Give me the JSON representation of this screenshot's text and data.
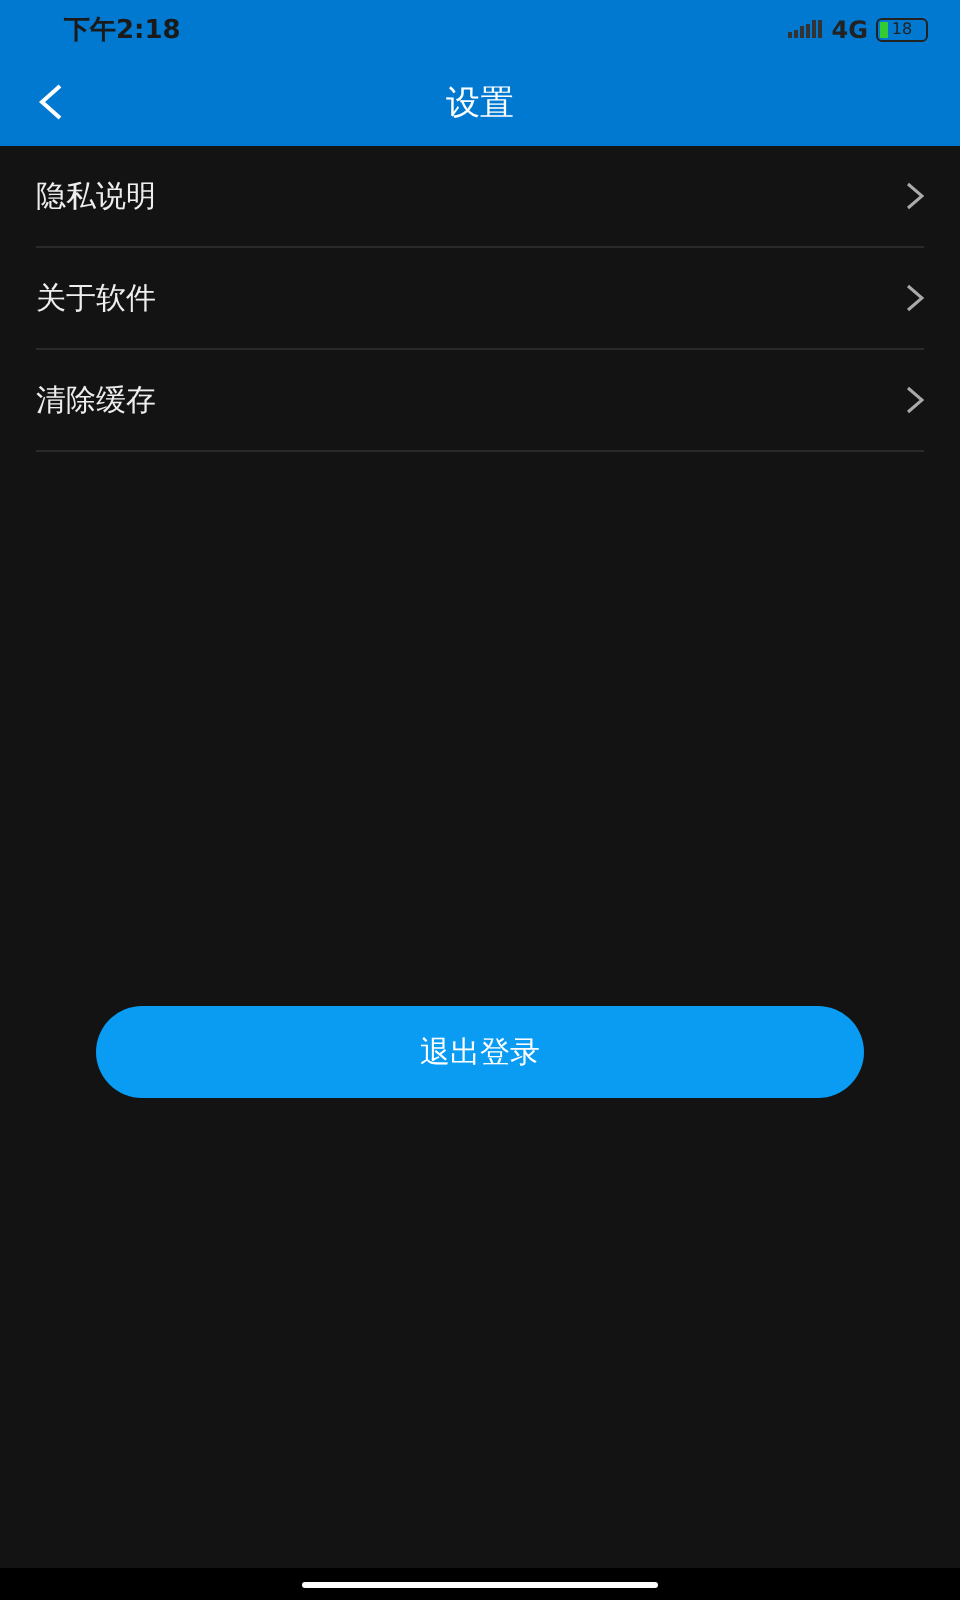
{
  "status_bar": {
    "time": "下午2:18",
    "network": "4G",
    "battery": "18"
  },
  "header": {
    "title": "设置"
  },
  "menu": [
    {
      "label": "隐私说明"
    },
    {
      "label": "关于软件"
    },
    {
      "label": "清除缓存"
    }
  ],
  "logout_button": "退出登录"
}
